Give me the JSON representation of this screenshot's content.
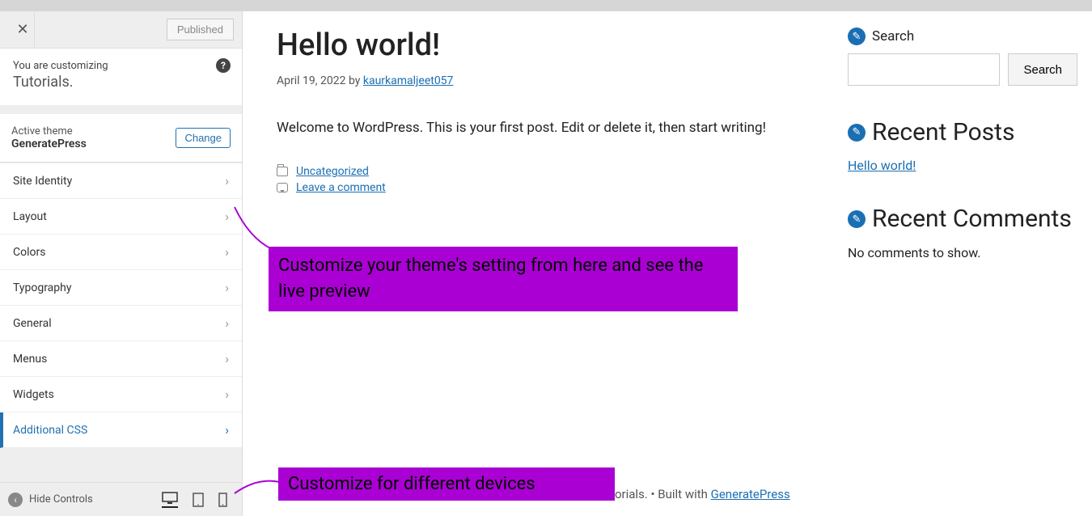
{
  "status_label": "Published",
  "context": {
    "prefix": "You are customizing",
    "site": "Tutorials."
  },
  "theme": {
    "label": "Active theme",
    "name": "GeneratePress",
    "change": "Change"
  },
  "menu": {
    "items": [
      {
        "label": "Site Identity",
        "active": false
      },
      {
        "label": "Layout",
        "active": false
      },
      {
        "label": "Colors",
        "active": false
      },
      {
        "label": "Typography",
        "active": false
      },
      {
        "label": "General",
        "active": false
      },
      {
        "label": "Menus",
        "active": false
      },
      {
        "label": "Widgets",
        "active": false
      },
      {
        "label": "Additional CSS",
        "active": true
      }
    ]
  },
  "footer": {
    "hide": "Hide Controls"
  },
  "post": {
    "title": "Hello world!",
    "date": "April 19, 2022",
    "by_label": "by",
    "author": "kaurkamaljeet057",
    "body": "Welcome to WordPress. This is your first post. Edit or delete it, then start writing!",
    "cat": "Uncategorized",
    "comment": "Leave a comment"
  },
  "widgets": {
    "search": {
      "title": "Search",
      "button": "Search"
    },
    "recent_posts": {
      "title": "Recent Posts",
      "items": [
        "Hello world!"
      ]
    },
    "recent_comments": {
      "title": "Recent Comments",
      "empty": "No comments to show."
    }
  },
  "credit": {
    "text": "orials. • Built with ",
    "link": "GeneratePress"
  },
  "annotations": {
    "a1": "Customize your theme's setting from here and see the live preview",
    "a2": "Customize for different devices"
  }
}
